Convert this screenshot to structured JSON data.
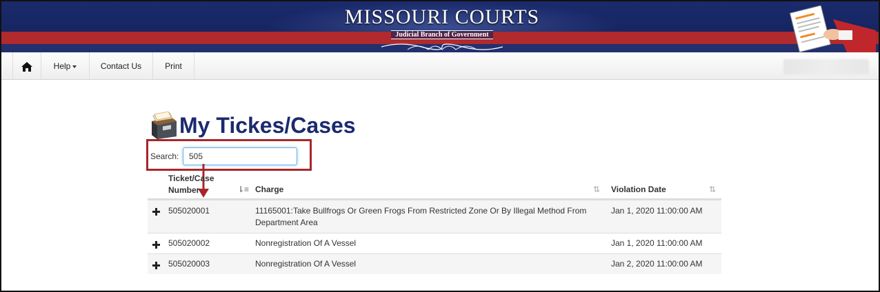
{
  "banner": {
    "logo_title": "MISSOURI COURTS",
    "logo_subtitle": "Judicial Branch of Government"
  },
  "nav": {
    "home_icon": "home-icon",
    "help_label": "Help",
    "contact_label": "Contact Us",
    "print_label": "Print"
  },
  "page": {
    "title": "My Tickes/Cases",
    "title_icon": "file-cabinet-icon"
  },
  "search": {
    "label": "Search:",
    "value": "505"
  },
  "table": {
    "columns": {
      "ticket_line1": "Ticket/Case",
      "ticket_line2": "Number",
      "charge": "Charge",
      "violation_date": "Violation Date"
    },
    "rows": [
      {
        "ticket": "505020001",
        "charge": "11165001:Take Bullfrogs Or Green Frogs From Restricted Zone Or By Illegal Method From Department Area",
        "date": "Jan 1, 2020 11:00:00 AM"
      },
      {
        "ticket": "505020002",
        "charge": "Nonregistration Of A Vessel",
        "date": "Jan 1, 2020 11:00:00 AM"
      },
      {
        "ticket": "505020003",
        "charge": "Nonregistration Of A Vessel",
        "date": "Jan 2, 2020 11:00:00 AM"
      }
    ]
  },
  "colors": {
    "banner_navy": "#1a2a6c",
    "banner_red": "#b02a2e",
    "title_navy": "#1b2a6e",
    "highlight_red": "#a7262a"
  }
}
